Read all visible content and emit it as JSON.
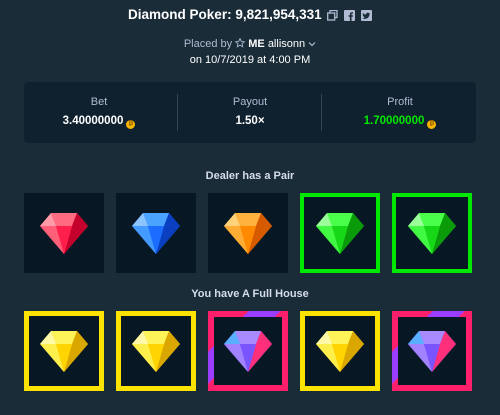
{
  "header": {
    "title": "Diamond Poker: 9,821,954,331",
    "placed_by_prefix": "Placed by",
    "user_badge": "ME",
    "username": "allisonn",
    "date_line": "on 10/7/2019 at 4:00 PM"
  },
  "stats": {
    "bet_label": "Bet",
    "bet_value": "3.40000000",
    "payout_label": "Payout",
    "payout_value": "1.50×",
    "profit_label": "Profit",
    "profit_value": "1.70000000"
  },
  "dealer": {
    "label": "Dealer has a Pair",
    "gems": [
      {
        "color": "red",
        "highlight": "none"
      },
      {
        "color": "blue",
        "highlight": "none"
      },
      {
        "color": "orange",
        "highlight": "none"
      },
      {
        "color": "green",
        "highlight": "green"
      },
      {
        "color": "green",
        "highlight": "green"
      }
    ]
  },
  "player": {
    "label": "You have A Full House",
    "gems": [
      {
        "color": "yellow",
        "highlight": "yellow"
      },
      {
        "color": "yellow",
        "highlight": "yellow"
      },
      {
        "color": "purple",
        "highlight": "rainbow"
      },
      {
        "color": "yellow",
        "highlight": "yellow"
      },
      {
        "color": "purple",
        "highlight": "rainbow"
      }
    ]
  },
  "colors": {
    "background": "#1a2c38",
    "panel": "#0f212e",
    "profit_green": "#00e701",
    "highlight_green": "#00e701",
    "highlight_yellow": "#fce400"
  },
  "icons": [
    "copy-icon",
    "facebook-icon",
    "twitter-icon",
    "star-icon",
    "chevron-down-icon",
    "coin-icon",
    "gem-icon"
  ]
}
